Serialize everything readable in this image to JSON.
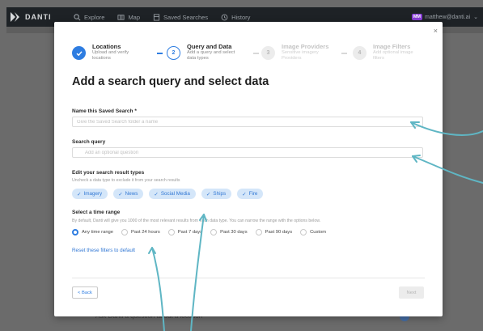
{
  "nav": {
    "logo_text": "DANTI",
    "items": [
      {
        "label": "Explore",
        "icon": "search-icon"
      },
      {
        "label": "Map",
        "icon": "map-icon"
      },
      {
        "label": "Saved Searches",
        "icon": "bookmark-icon"
      },
      {
        "label": "History",
        "icon": "history-icon"
      }
    ],
    "user_initials": "MM",
    "user_email": "matthew@danti.ai"
  },
  "background": {
    "ask_text": "Ask Danti a question about a location"
  },
  "modal": {
    "close_label": "×",
    "steps": [
      {
        "number": "✓",
        "title": "Locations",
        "subtitle": "Upload and verify locations",
        "state": "done"
      },
      {
        "number": "2",
        "title": "Query and Data",
        "subtitle": "Add a query and select data types",
        "state": "active"
      },
      {
        "number": "3",
        "title": "Image Providers",
        "subtitle": "Sensitive imagery Providers",
        "state": "todo"
      },
      {
        "number": "4",
        "title": "Image Filters",
        "subtitle": "Add optional image filters",
        "state": "todo"
      }
    ],
    "title": "Add a search query and select data",
    "name_field": {
      "label": "Name this Saved Search *",
      "placeholder": "Give the Saved Search folder a name",
      "value": ""
    },
    "query_field": {
      "label": "Search query",
      "placeholder": "Add an optional question",
      "value": ""
    },
    "result_types": {
      "label": "Edit your search result types",
      "helper": "Uncheck a data type to exclude it from your search results",
      "chips": [
        "Imagery",
        "News",
        "Social Media",
        "Ships",
        "Fire"
      ]
    },
    "time_range": {
      "label": "Select a time range",
      "helper": "By default, Danti will give you 1000 of the most relevant results from each data type. You can narrow the range with the options below.",
      "options": [
        "Any time range",
        "Past 24 hours",
        "Past 7 days",
        "Past 30 days",
        "Past 90 days",
        "Custom"
      ],
      "selected": "Any time range"
    },
    "reset_label": "Reset these filters to default",
    "back_label": "< Back",
    "next_label": "Next"
  },
  "colors": {
    "accent": "#2e7de1",
    "chip_bg": "#d4e6f9",
    "annotation": "#5fb6c4",
    "nav_bg": "#1e2226"
  }
}
